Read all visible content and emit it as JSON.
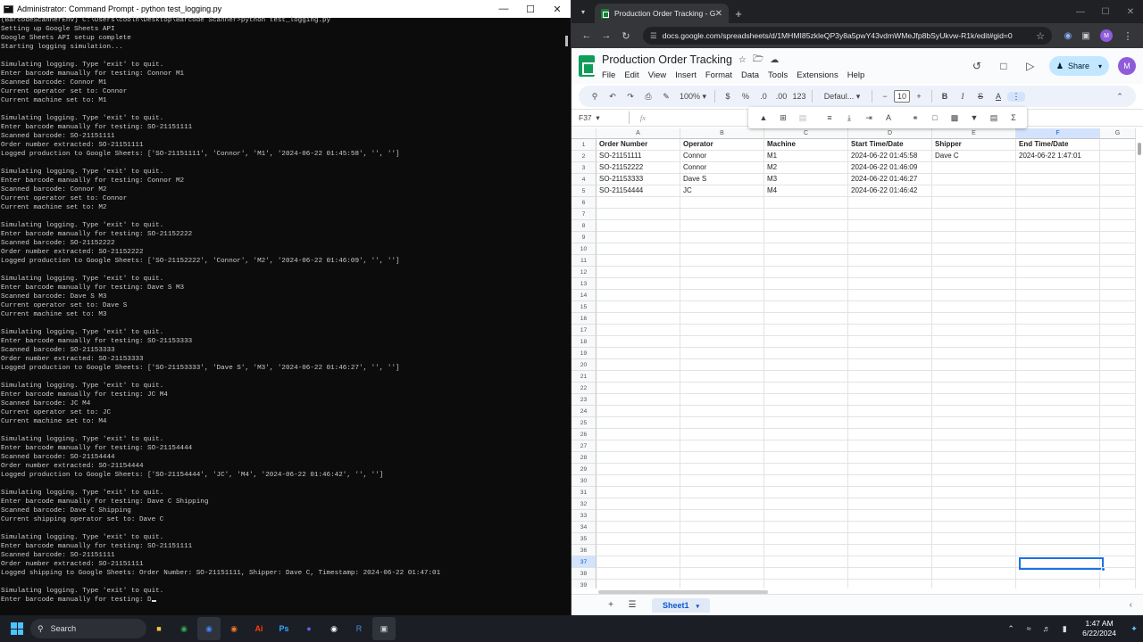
{
  "terminal": {
    "title": "Administrator: Command Prompt - python  test_logging.py",
    "lines": [
      "(BarcodeScannerEnv) C:\\Users\\coolh\\Desktop\\Barcode Scanner>python test_logging.py",
      "Setting up Google Sheets API",
      "Google Sheets API setup complete",
      "Starting logging simulation...",
      "",
      "Simulating logging. Type 'exit' to quit.",
      "Enter barcode manually for testing: Connor M1",
      "Scanned barcode: Connor M1",
      "Current operator set to: Connor",
      "Current machine set to: M1",
      "",
      "Simulating logging. Type 'exit' to quit.",
      "Enter barcode manually for testing: SO-21151111",
      "Scanned barcode: SO-21151111",
      "Order number extracted: SO-21151111",
      "Logged production to Google Sheets: ['SO-21151111', 'Connor', 'M1', '2024-06-22 01:45:58', '', '']",
      "",
      "Simulating logging. Type 'exit' to quit.",
      "Enter barcode manually for testing: Connor M2",
      "Scanned barcode: Connor M2",
      "Current operator set to: Connor",
      "Current machine set to: M2",
      "",
      "Simulating logging. Type 'exit' to quit.",
      "Enter barcode manually for testing: SO-21152222",
      "Scanned barcode: SO-21152222",
      "Order number extracted: SO-21152222",
      "Logged production to Google Sheets: ['SO-21152222', 'Connor', 'M2', '2024-06-22 01:46:09', '', '']",
      "",
      "Simulating logging. Type 'exit' to quit.",
      "Enter barcode manually for testing: Dave S M3",
      "Scanned barcode: Dave S M3",
      "Current operator set to: Dave S",
      "Current machine set to: M3",
      "",
      "Simulating logging. Type 'exit' to quit.",
      "Enter barcode manually for testing: SO-21153333",
      "Scanned barcode: SO-21153333",
      "Order number extracted: SO-21153333",
      "Logged production to Google Sheets: ['SO-21153333', 'Dave S', 'M3', '2024-06-22 01:46:27', '', '']",
      "",
      "Simulating logging. Type 'exit' to quit.",
      "Enter barcode manually for testing: JC M4",
      "Scanned barcode: JC M4",
      "Current operator set to: JC",
      "Current machine set to: M4",
      "",
      "Simulating logging. Type 'exit' to quit.",
      "Enter barcode manually for testing: SO-21154444",
      "Scanned barcode: SO-21154444",
      "Order number extracted: SO-21154444",
      "Logged production to Google Sheets: ['SO-21154444', 'JC', 'M4', '2024-06-22 01:46:42', '', '']",
      "",
      "Simulating logging. Type 'exit' to quit.",
      "Enter barcode manually for testing: Dave C Shipping",
      "Scanned barcode: Dave C Shipping",
      "Current shipping operator set to: Dave C",
      "",
      "Simulating logging. Type 'exit' to quit.",
      "Enter barcode manually for testing: SO-21151111",
      "Scanned barcode: SO-21151111",
      "Order number extracted: SO-21151111",
      "Logged shipping to Google Sheets: Order Number: SO-21151111, Shipper: Dave C, Timestamp: 2024-06-22 01:47:01",
      "",
      "Simulating logging. Type 'exit' to quit.",
      "Enter barcode manually for testing: D"
    ]
  },
  "browser": {
    "tab_title": "Production Order Tracking - Go",
    "url": "docs.google.com/spreadsheets/d/1MHMI85zkleQP3y8a5pwY43vdmWMeJfp8bSyUkvw-R1k/edit#gid=0",
    "profile_initial": "M"
  },
  "sheets": {
    "doc_title": "Production Order Tracking",
    "menu": [
      "File",
      "Edit",
      "View",
      "Insert",
      "Format",
      "Data",
      "Tools",
      "Extensions",
      "Help"
    ],
    "share_label": "Share",
    "avatar_initial": "M",
    "zoom": "100%",
    "currency": "$",
    "percent": "%",
    "dec_dec": ".0",
    "dec_inc": ".00",
    "number_fmt": "123",
    "font": "Defaul...",
    "font_size": "10",
    "name_box": "F37",
    "fx": "fx",
    "columns": [
      "A",
      "B",
      "C",
      "D",
      "E",
      "F",
      "G"
    ],
    "selected_column": "F",
    "selected_row": "37",
    "header_row": [
      "Order Number",
      "Operator",
      "Machine",
      "Start Time/Date",
      "Shipper",
      "End Time/Date"
    ],
    "data_rows": [
      [
        "SO-21151111",
        "Connor",
        "M1",
        "2024-06-22 01:45:58",
        "Dave C",
        "2024-06-22 1:47:01"
      ],
      [
        "SO-21152222",
        "Connor",
        "M2",
        "2024-06-22 01:46:09",
        "",
        ""
      ],
      [
        "SO-21153333",
        "Dave S",
        "M3",
        "2024-06-22 01:46:27",
        "",
        ""
      ],
      [
        "SO-21154444",
        "JC",
        "M4",
        "2024-06-22 01:46:42",
        "",
        ""
      ]
    ],
    "row_numbers": [
      "1",
      "2",
      "3",
      "4",
      "5",
      "6",
      "7",
      "8",
      "9",
      "10",
      "11",
      "12",
      "13",
      "14",
      "15",
      "16",
      "17",
      "18",
      "19",
      "20",
      "21",
      "22",
      "23",
      "24",
      "25",
      "26",
      "27",
      "28",
      "29",
      "30",
      "31",
      "32",
      "33",
      "34",
      "35",
      "36",
      "37",
      "38",
      "39"
    ],
    "sheet_tab": "Sheet1"
  },
  "taskbar": {
    "search_label": "Search",
    "time": "1:47 AM",
    "date": "6/22/2024"
  },
  "colors": {
    "terminal_bg": "#0c0c0c",
    "terminal_text": "#cccccc",
    "sheets_green": "#0f9d58",
    "selection_blue": "#1a73e8",
    "share_bg": "#c2e7ff"
  }
}
